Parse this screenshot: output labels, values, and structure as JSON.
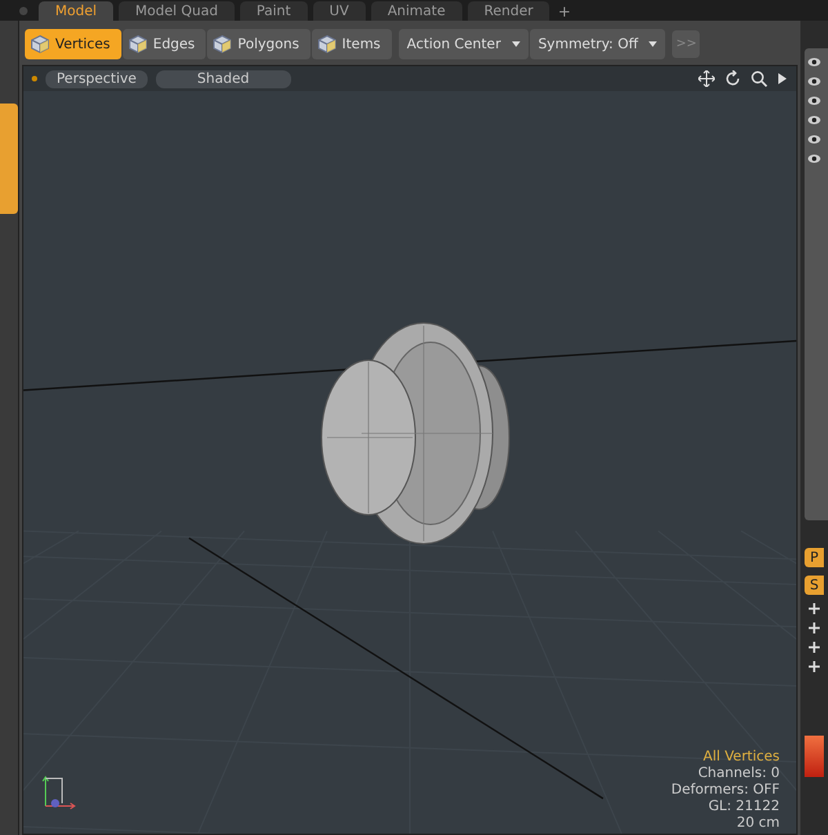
{
  "tabs": [
    {
      "label": "Model",
      "selected": true
    },
    {
      "label": "Model Quad",
      "selected": false
    },
    {
      "label": "Paint",
      "selected": false
    },
    {
      "label": "UV",
      "selected": false
    },
    {
      "label": "Animate",
      "selected": false
    },
    {
      "label": "Render",
      "selected": false
    }
  ],
  "add_tab": "+",
  "toolbar": {
    "modes": [
      {
        "label": "Vertices",
        "selected": true
      },
      {
        "label": "Edges",
        "selected": false
      },
      {
        "label": "Polygons",
        "selected": false
      },
      {
        "label": "Items",
        "selected": false
      }
    ],
    "dropdowns": [
      "Action Center",
      "Symmetry: Off"
    ],
    "more": ">>"
  },
  "viewport": {
    "view": "Perspective",
    "shading": "Shaded",
    "stats": [
      {
        "text": "All Vertices",
        "kind": "title"
      },
      {
        "text": "Channels: 0",
        "kind": "info"
      },
      {
        "text": "Deformers: OFF",
        "kind": "info"
      },
      {
        "text": "GL: 21122",
        "kind": "info"
      },
      {
        "text": "20 cm",
        "kind": "info"
      }
    ]
  },
  "right_panel": {
    "buttons": [
      "P",
      "S"
    ]
  }
}
